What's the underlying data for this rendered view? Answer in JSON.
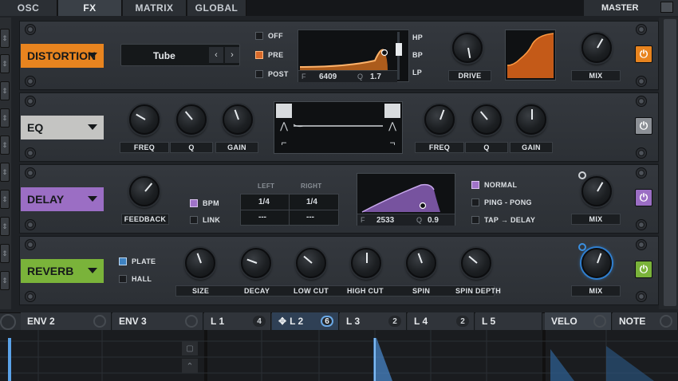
{
  "top_tabs": [
    "OSC",
    "FX",
    "MATRIX",
    "GLOBAL"
  ],
  "master_label": "MASTER",
  "distortion": {
    "name": "DISTORTION",
    "mode": "Tube",
    "routing": [
      "OFF",
      "PRE",
      "POST"
    ],
    "routing_selected": "PRE",
    "filter_types": [
      "HP",
      "BP",
      "LP"
    ],
    "freq_label": "F",
    "freq_value": "6409",
    "q_label": "Q",
    "q_value": "1.7",
    "drive_label": "DRIVE",
    "mix_label": "MIX",
    "color": "#e8841f"
  },
  "eq": {
    "name": "EQ",
    "low_labels": [
      "FREQ",
      "Q",
      "GAIN"
    ],
    "high_labels": [
      "FREQ",
      "Q",
      "GAIN"
    ],
    "color": "#c4c4c2"
  },
  "delay": {
    "name": "DELAY",
    "feedback_label": "FEEDBACK",
    "bpm_label": "BPM",
    "link_label": "LINK",
    "left_label": "LEFT",
    "right_label": "RIGHT",
    "left_value": "1/4",
    "right_value": "1/4",
    "left_value2": "---",
    "right_value2": "---",
    "freq_label": "F",
    "freq_value": "2533",
    "q_label": "Q",
    "q_value": "0.9",
    "modes": [
      "NORMAL",
      "PING - PONG",
      "TAP → DELAY"
    ],
    "mix_label": "MIX",
    "color": "#9b6ec4"
  },
  "reverb": {
    "name": "REVERB",
    "plate_label": "PLATE",
    "hall_label": "HALL",
    "knobs": [
      "SIZE",
      "DECAY",
      "LOW CUT",
      "HIGH CUT",
      "SPIN",
      "SPIN DEPTH"
    ],
    "mix_label": "MIX",
    "color": "#7ab33a"
  },
  "bottom_tabs": [
    {
      "label": "ENV 2"
    },
    {
      "label": "ENV 3"
    },
    {
      "label": "L 1",
      "count": "4"
    },
    {
      "label": "L 2",
      "count": "6"
    },
    {
      "label": "L 3",
      "count": "2"
    },
    {
      "label": "L 4",
      "count": "2"
    },
    {
      "label": "L 5"
    },
    {
      "label": "VELO"
    },
    {
      "label": "NOTE"
    }
  ]
}
